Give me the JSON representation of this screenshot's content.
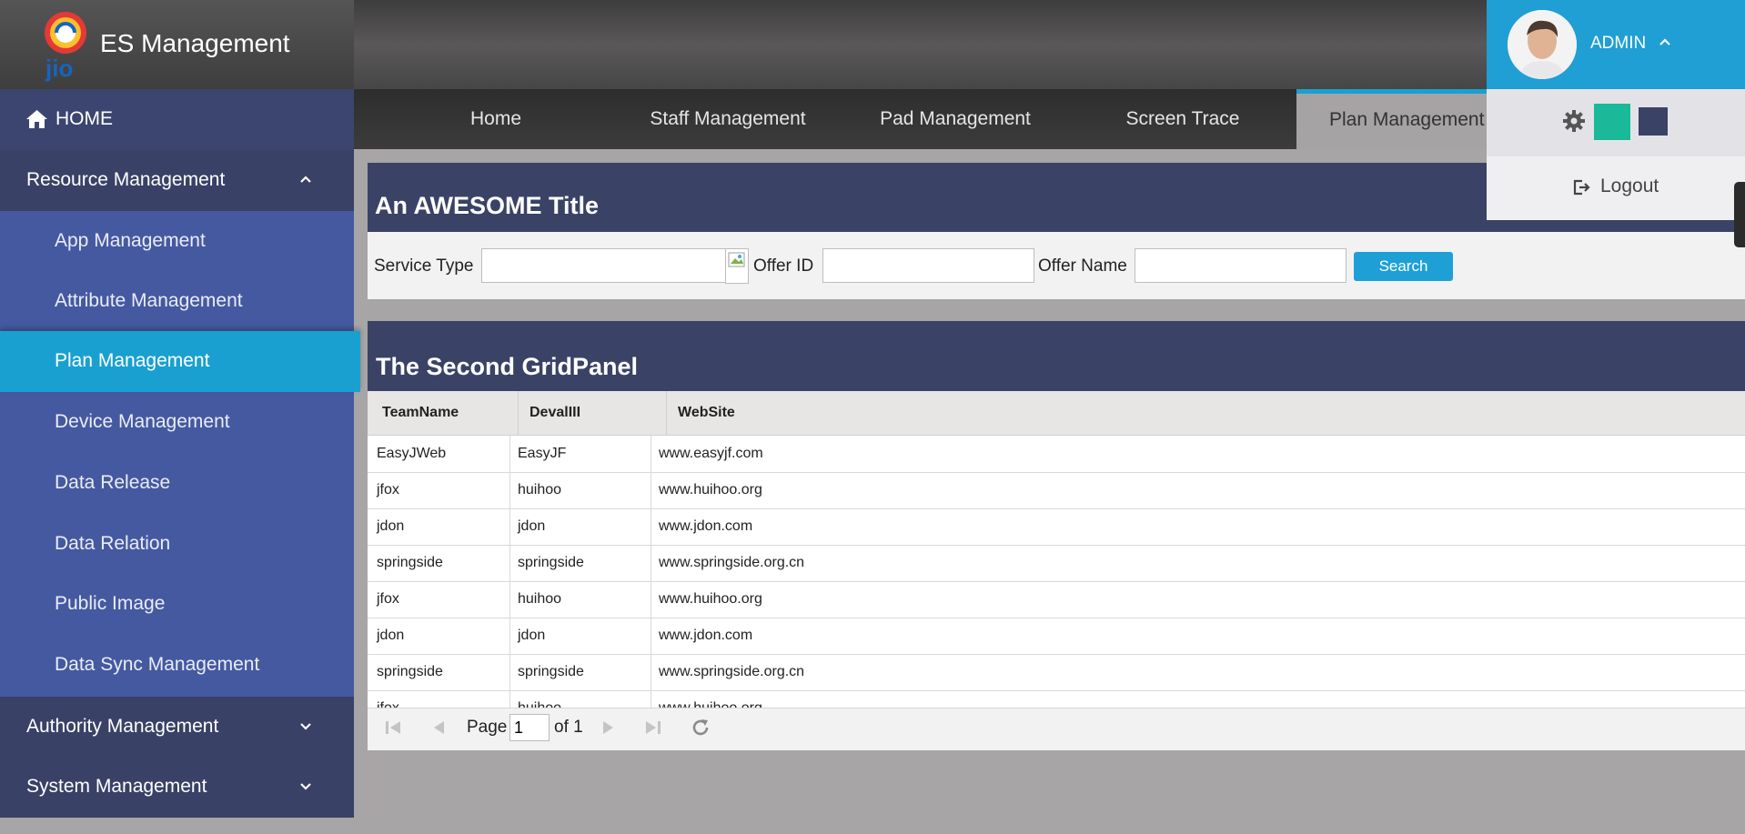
{
  "app": {
    "title": "ES Management",
    "logo_text": "jio"
  },
  "sidebar": {
    "home_label": "HOME",
    "groups": [
      {
        "label": "Resource Management",
        "expanded": true
      },
      {
        "label": "Authority Management",
        "expanded": false
      },
      {
        "label": "System Management",
        "expanded": false
      }
    ],
    "resource_items": [
      {
        "label": "App Management"
      },
      {
        "label": "Attribute Management"
      },
      {
        "label": "Plan Management",
        "active": true
      },
      {
        "label": "Device Management"
      },
      {
        "label": "Data Release"
      },
      {
        "label": "Data Relation"
      },
      {
        "label": "Public Image"
      },
      {
        "label": "Data Sync Management"
      }
    ]
  },
  "tabs": [
    {
      "label": "Home"
    },
    {
      "label": "Staff Management"
    },
    {
      "label": "Pad Management"
    },
    {
      "label": "Screen Trace"
    },
    {
      "label": "Plan Management",
      "active": true
    }
  ],
  "form_panel": {
    "title": "An AWESOME Title",
    "service_type_label": "Service Type",
    "service_type_value": "",
    "offer_id_label": "Offer ID",
    "offer_id_value": "",
    "offer_name_label": "Offer Name",
    "offer_name_value": "",
    "search_label": "Search"
  },
  "grid_panel": {
    "title": "The Second GridPanel",
    "columns": [
      "TeamName",
      "DevalIII",
      "WebSite"
    ],
    "rows": [
      [
        "EasyJWeb",
        "EasyJF",
        "www.easyjf.com"
      ],
      [
        "jfox",
        "huihoo",
        "www.huihoo.org"
      ],
      [
        "jdon",
        "jdon",
        "www.jdon.com"
      ],
      [
        "springside",
        "springside",
        "www.springside.org.cn"
      ],
      [
        "jfox",
        "huihoo",
        "www.huihoo.org"
      ],
      [
        "jdon",
        "jdon",
        "www.jdon.com"
      ],
      [
        "springside",
        "springside",
        "www.springside.org.cn"
      ],
      [
        "jfox",
        "huihoo",
        "www.huihoo.org"
      ]
    ],
    "pager": {
      "page_label": "Page",
      "current_page": "1",
      "of_label": "of 1"
    }
  },
  "user_menu": {
    "username": "ADMIN",
    "logout_label": "Logout",
    "theme_colors": [
      "#19b999",
      "#3a4266"
    ]
  },
  "colors": {
    "accent": "#1aa0d0",
    "panel_header": "#3a4266",
    "sidebar_sub": "#4559a0",
    "sidebar_group": "#394166"
  }
}
